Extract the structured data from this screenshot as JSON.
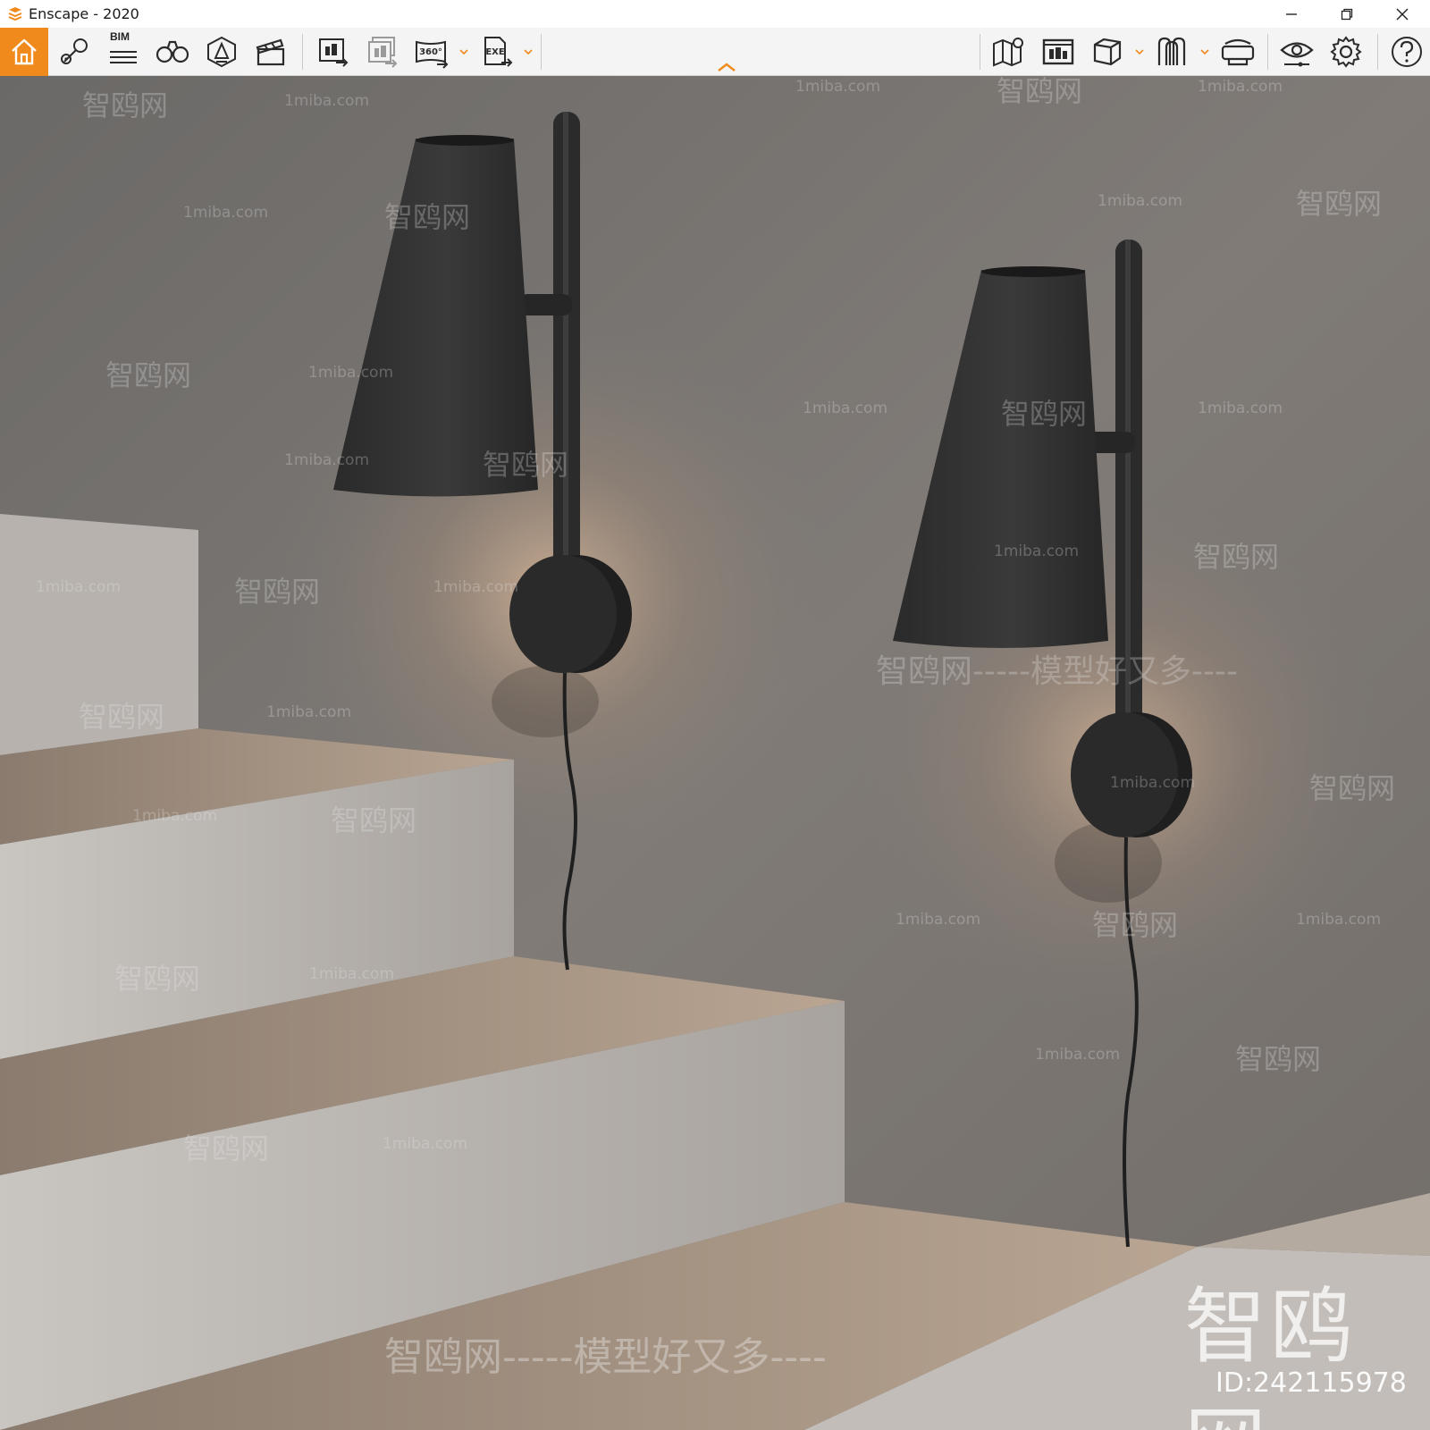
{
  "window": {
    "title": "Enscape - 2020"
  },
  "toolbar": {
    "bim_label": "BIM",
    "icons": [
      "home-icon",
      "location-pin-icon",
      "bim-info-icon",
      "binoculars-icon",
      "light-view-icon",
      "video-clapper-icon",
      "render-screenshot-icon",
      "batch-render-icon",
      "panorama-360-icon",
      "exe-export-icon",
      "map-icon",
      "asset-library-icon",
      "cube-icon",
      "material-icon",
      "vr-headset-icon",
      "visibility-icon",
      "settings-icon",
      "help-icon"
    ],
    "colors": {
      "accent": "#f08a1c",
      "icon": "#2b2b2b"
    }
  },
  "watermarks": {
    "site_url": "1miba.com",
    "site_cn": "智鸥网",
    "slogan": "模型好又多",
    "slogan_line": "智鸥网-----模型好又多----",
    "big_logo": "智鸥网",
    "id_text": "ID:242115978"
  }
}
